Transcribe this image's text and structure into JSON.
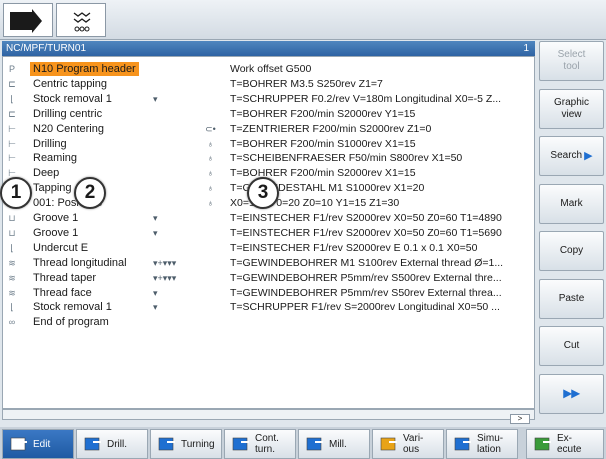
{
  "path": {
    "title": "NC/MPF/TURN01",
    "channel": "1"
  },
  "rows": [
    {
      "icon": "P",
      "name": "N10 Program header",
      "flags": "",
      "ri": "",
      "desc": "Work offset G500",
      "hl": true
    },
    {
      "icon": "⊏",
      "name": "Centric tapping",
      "flags": "",
      "ri": "",
      "desc": "T=BOHRER M3.5 S250rev Z1=7"
    },
    {
      "icon": "⌊",
      "name": "Stock removal 1",
      "flags": "▾",
      "ri": "",
      "desc": "T=SCHRUPPER F0.2/rev V=180m Longitudinal X0=-5 Z..."
    },
    {
      "icon": "⊏",
      "name": "Drilling centric",
      "flags": "",
      "ri": "",
      "desc": "T=BOHRER F200/min S2000rev Y1=15"
    },
    {
      "icon": "⊢",
      "name": "N20 Centering",
      "flags": "",
      "ri": "⊂•",
      "desc": "T=ZENTRIERER F200/min S2000rev Z1=0"
    },
    {
      "icon": "⊢",
      "name": "Drilling",
      "flags": "",
      "ri": "♁",
      "desc": "T=BOHRER F200/min S1000rev X1=15"
    },
    {
      "icon": "⊢",
      "name": "Reaming",
      "flags": "",
      "ri": "♁",
      "desc": "T=SCHEIBENFRAESER F50/min S800rev X1=50"
    },
    {
      "icon": "⊢",
      "name": "Deep",
      "flags": "",
      "ri": "♁",
      "desc": "T=BOHRER F200/min S2000rev X1=15"
    },
    {
      "icon": "⊢",
      "name": "Tapping",
      "flags": "",
      "ri": "♁",
      "desc": "T=GEWINDESTAHL M1 S1000rev X1=20"
    },
    {
      "icon": "⊢",
      "name": "001: Positions",
      "flags": "",
      "ri": "♁",
      "desc": "X0=100 Y0=20 Z0=10 Y1=15 Z1=30"
    },
    {
      "icon": "⊔",
      "name": "Groove 1",
      "flags": "▾",
      "ri": "",
      "desc": "T=EINSTECHER F1/rev S2000rev X0=50 Z0=60 T1=4890"
    },
    {
      "icon": "⊔",
      "name": "Groove 1",
      "flags": "▾",
      "ri": "",
      "desc": "T=EINSTECHER F1/rev S2000rev X0=50 Z0=60 T1=5690"
    },
    {
      "icon": "⌊",
      "name": "Undercut E",
      "flags": "",
      "ri": "",
      "desc": "T=EINSTECHER F1/rev S2000rev E 0.1 x 0.1 X0=50"
    },
    {
      "icon": "≋",
      "name": "Thread longitudinal",
      "flags": "▾+▾▾▾",
      "ri": "",
      "desc": "T=GEWINDEBOHRER M1 S100rev External thread Ø=1..."
    },
    {
      "icon": "≋",
      "name": "Thread taper",
      "flags": "▾+▾▾▾",
      "ri": "",
      "desc": "T=GEWINDEBOHRER P5mm/rev S500rev External thre..."
    },
    {
      "icon": "≋",
      "name": "Thread face",
      "flags": "▾",
      "ri": "",
      "desc": "T=GEWINDEBOHRER P5mm/rev S50rev External threa..."
    },
    {
      "icon": "⌊",
      "name": "Stock removal 1",
      "flags": "▾",
      "ri": "",
      "desc": "T=SCHRUPPER F1/rev S=2000rev Longitudinal X0=50 ..."
    },
    {
      "icon": "∞",
      "name": "End of program",
      "flags": "",
      "ri": "",
      "desc": ""
    }
  ],
  "goto_label": ">",
  "sidebar": [
    {
      "label": "Select\ntool",
      "disabled": true
    },
    {
      "label": "Graphic\nview",
      "disabled": false
    },
    {
      "label": "Search",
      "disabled": false,
      "arrow": "▶"
    },
    {
      "label": "Mark",
      "disabled": false
    },
    {
      "label": "Copy",
      "disabled": false
    },
    {
      "label": "Paste",
      "disabled": false
    },
    {
      "label": "Cut",
      "disabled": false
    },
    {
      "label": "▸▸",
      "disabled": false,
      "more": true
    }
  ],
  "hkeys": [
    {
      "label": "Edit",
      "active": true
    },
    {
      "label": "Drill.",
      "active": false
    },
    {
      "label": "Turning",
      "active": false
    },
    {
      "label": "Cont.\nturn.",
      "active": false
    },
    {
      "label": "Mill.",
      "active": false
    },
    {
      "label": "Vari-\nous",
      "active": false
    },
    {
      "label": "Simu-\nlation",
      "active": false
    },
    {
      "label": "Ex-\necute",
      "active": false
    }
  ],
  "callouts": [
    "1",
    "2",
    "3"
  ],
  "colors": {
    "header_blue": "#2e63a3",
    "highlight": "#f7941d",
    "accent": "#1f6fd1"
  }
}
